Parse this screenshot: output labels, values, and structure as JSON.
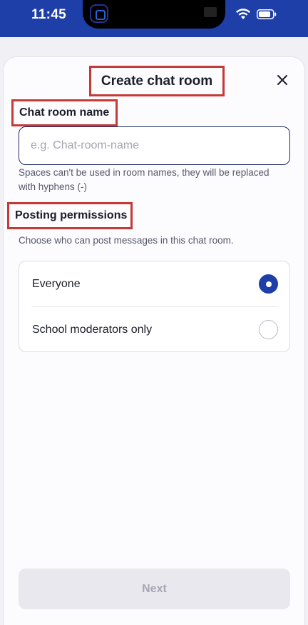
{
  "status_bar": {
    "time": "11:45",
    "icons": [
      "wifi-icon",
      "battery-icon"
    ]
  },
  "modal": {
    "title": "Create chat room",
    "close_icon": "close-icon"
  },
  "room_name": {
    "label": "Chat room name",
    "placeholder": "e.g. Chat-room-name",
    "value": "",
    "helper": "Spaces can't be used in room names, they will be replaced with hyphens (-)"
  },
  "permissions": {
    "label": "Posting permissions",
    "description": "Choose who can post messages in this chat room.",
    "options": [
      {
        "label": "Everyone",
        "selected": true
      },
      {
        "label": "School moderators only",
        "selected": false
      }
    ]
  },
  "footer": {
    "next_label": "Next",
    "next_enabled": false
  },
  "colors": {
    "accent": "#1f3fa8",
    "highlight": "#c43a36",
    "disabled_bg": "#e9e8ee",
    "disabled_text": "#a5a6b3"
  }
}
